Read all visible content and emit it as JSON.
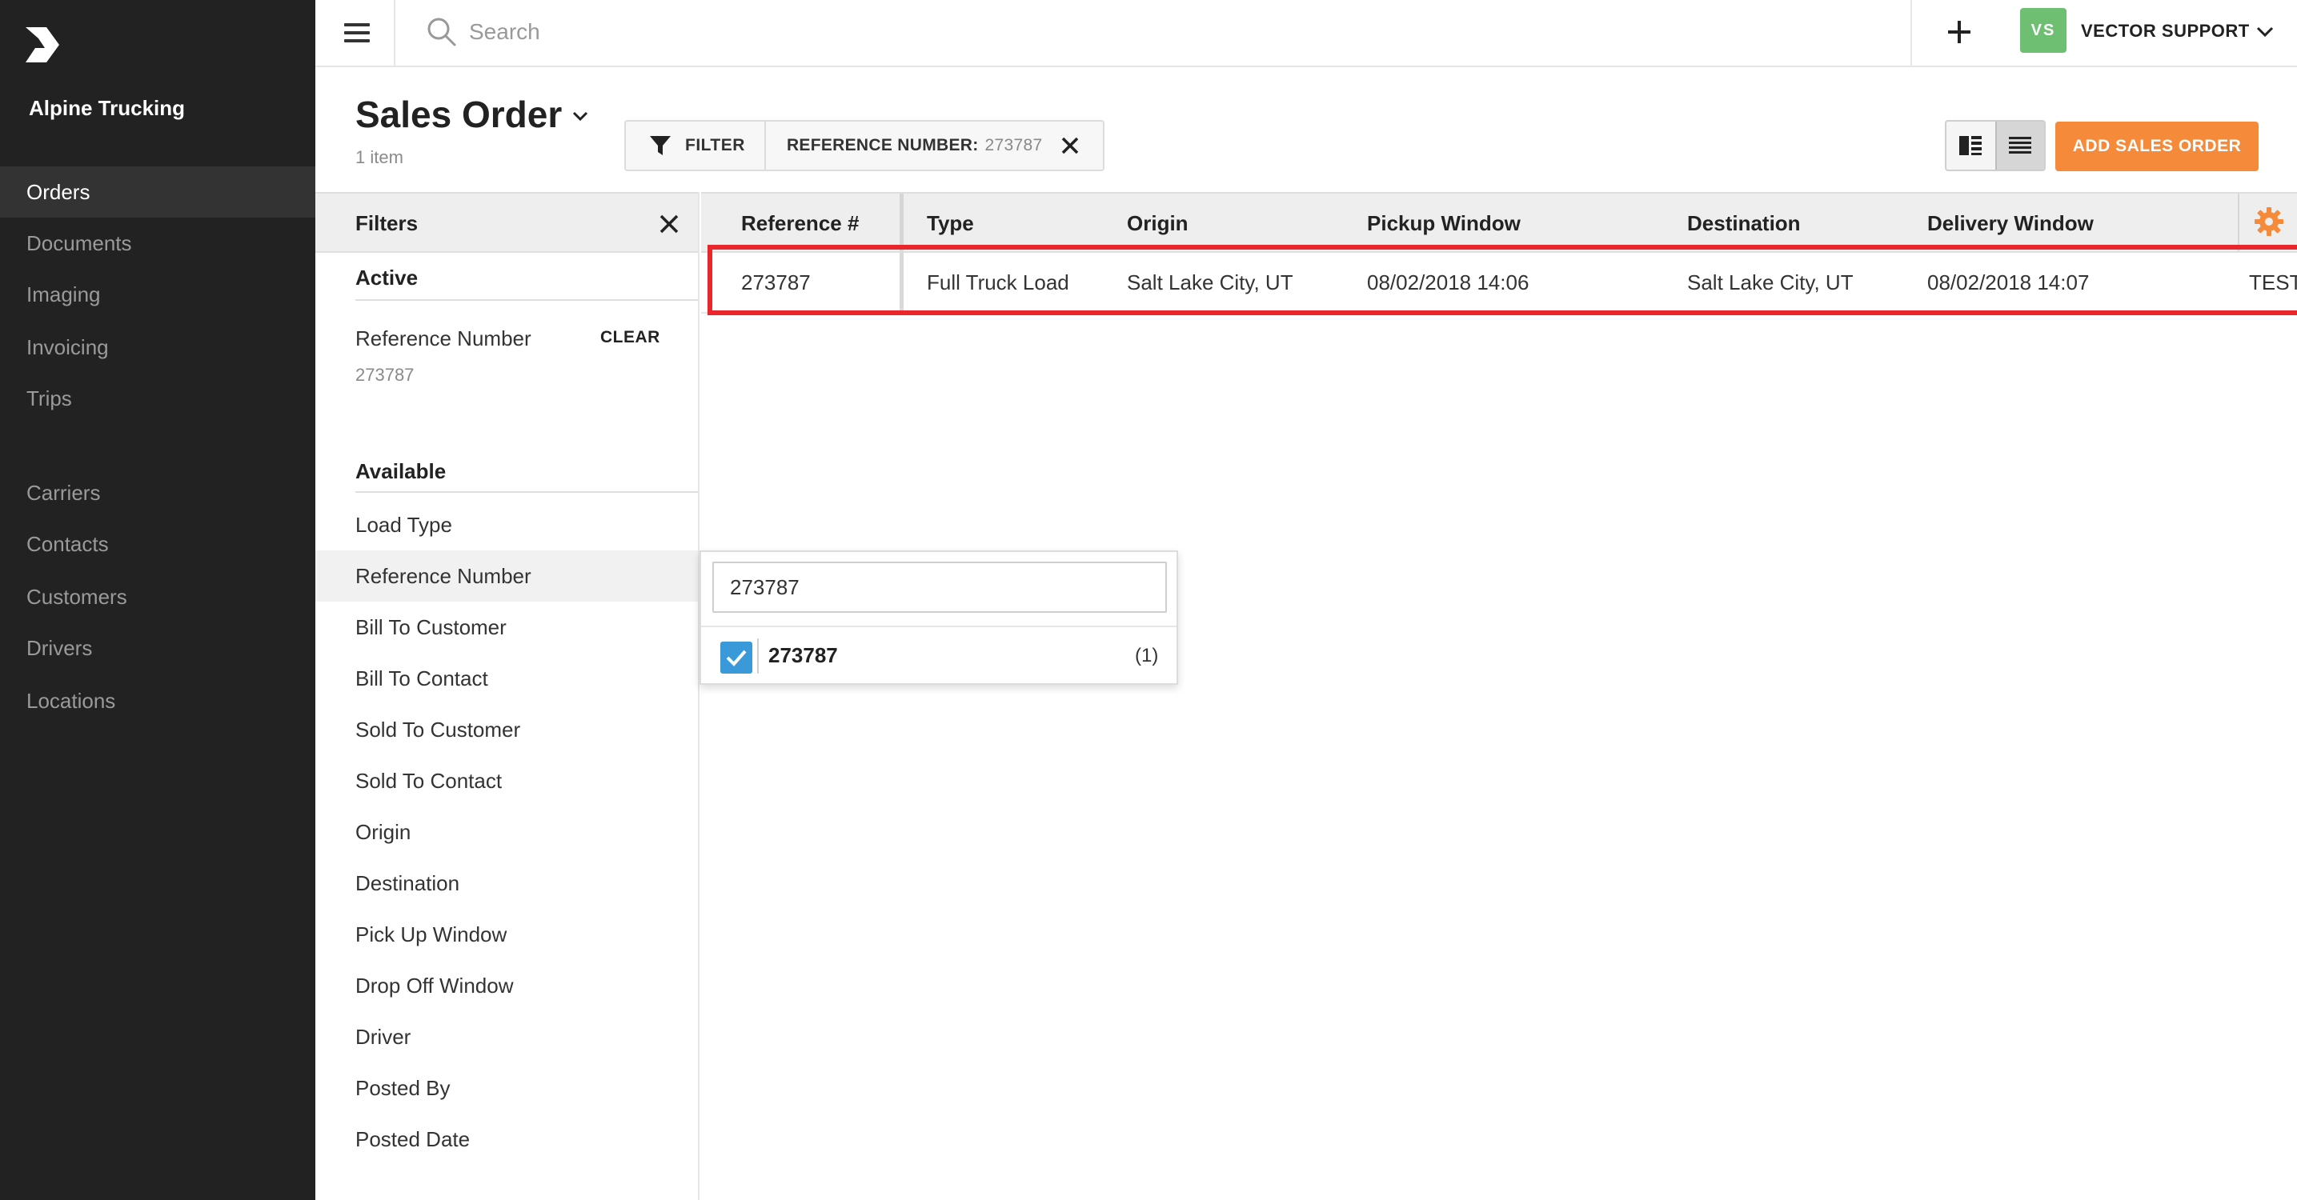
{
  "app": {
    "company": "Alpine Trucking"
  },
  "sidebar": {
    "items": [
      {
        "label": "Orders",
        "active": true
      },
      {
        "label": "Documents"
      },
      {
        "label": "Imaging"
      },
      {
        "label": "Invoicing"
      },
      {
        "label": "Trips"
      },
      {
        "label": "Carriers"
      },
      {
        "label": "Contacts"
      },
      {
        "label": "Customers"
      },
      {
        "label": "Drivers"
      },
      {
        "label": "Locations"
      }
    ]
  },
  "topbar": {
    "search_placeholder": "Search",
    "user_initials": "VS",
    "user_name": "VECTOR SUPPORT",
    "avatar_color": "#6fbf73"
  },
  "header": {
    "title": "Sales Order",
    "item_count": "1 item",
    "filter_label": "FILTER",
    "chip_label": "REFERENCE NUMBER:",
    "chip_value": "273787",
    "add_button": "ADD SALES ORDER",
    "accent_color": "#f58a3a"
  },
  "filters": {
    "title": "Filters",
    "active_title": "Active",
    "active_filter": {
      "name": "Reference Number",
      "clear": "CLEAR",
      "value": "273787"
    },
    "available_title": "Available",
    "available": [
      "Load Type",
      "Reference Number",
      "Bill To Customer",
      "Bill To Contact",
      "Sold To Customer",
      "Sold To Contact",
      "Origin",
      "Destination",
      "Pick Up Window",
      "Drop Off Window",
      "Driver",
      "Posted By",
      "Posted Date"
    ]
  },
  "table": {
    "columns": [
      "Reference #",
      "Type",
      "Origin",
      "Pickup Window",
      "Destination",
      "Delivery Window"
    ],
    "rows": [
      {
        "reference": "273787",
        "type": "Full Truck Load",
        "origin": "Salt Lake City, UT",
        "pickup": "08/02/2018 14:06",
        "destination": "Salt Lake City, UT",
        "delivery": "08/02/2018 14:07",
        "extra": "TEST"
      }
    ],
    "highlight_color": "#e8262b"
  },
  "popover": {
    "input_value": "273787",
    "option_label": "273787",
    "option_count": "(1)",
    "checkbox_color": "#3a9ad9"
  }
}
